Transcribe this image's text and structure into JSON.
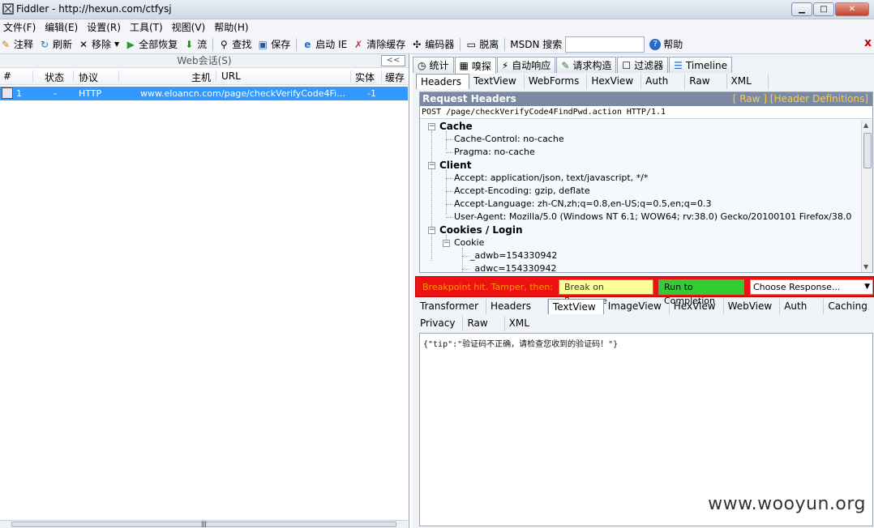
{
  "window": {
    "title": "Fiddler - http://hexun.com/ctfysj"
  },
  "menu": [
    "文件(F)",
    "编辑(E)",
    "设置(R)",
    "工具(T)",
    "视图(V)",
    "帮助(H)"
  ],
  "toolbar": {
    "comment": "注释",
    "refresh": "刷新",
    "remove": "移除",
    "resume_all": "全部恢复",
    "stream": "流",
    "find": "查找",
    "save": "保存",
    "launch_ie": "启动 IE",
    "clear_cache": "清除缓存",
    "encoder": "编码器",
    "tearoff": "脱离",
    "msdn_search": "MSDN 搜索",
    "help": "帮助",
    "close": "x"
  },
  "sessions": {
    "title": "Web会话(S)",
    "collapse": "<<",
    "columns": [
      "#",
      "状态",
      "协议",
      "主机",
      "URL",
      "实体",
      "缓存"
    ],
    "rows": [
      {
        "id": "1",
        "status": "-",
        "protocol": "HTTP",
        "host": "www.eloancn.com",
        "url": "/page/checkVerifyCode4Fi…",
        "body": "-1"
      }
    ]
  },
  "tabs": {
    "main": [
      {
        "label": "统计",
        "icon": "stopwatch-icon"
      },
      {
        "label": "嗅探",
        "icon": "inspect-icon"
      },
      {
        "label": "自动响应",
        "icon": "lightning-icon"
      },
      {
        "label": "请求构造",
        "icon": "compose-icon"
      },
      {
        "label": "过滤器",
        "icon": "checkbox-icon"
      },
      {
        "label": "Timeline",
        "icon": "timeline-icon"
      }
    ],
    "request_sub": [
      "Headers",
      "TextView",
      "WebForms",
      "HexView",
      "Auth",
      "Raw",
      "XML"
    ],
    "response_sub_row1": [
      "Transformer",
      "Headers",
      "TextView",
      "ImageView",
      "HexView",
      "WebView",
      "Auth",
      "Caching"
    ],
    "response_sub_row2": [
      "Privacy",
      "Raw",
      "XML"
    ]
  },
  "request": {
    "header_title": "Request Headers",
    "links": "[ Raw ]   [Header Definitions]",
    "request_line": "POST /page/checkVerifyCode4FindPwd.action HTTP/1.1",
    "groups": {
      "cache": "Cache",
      "cache_control": "Cache-Control: no-cache",
      "pragma": "Pragma: no-cache",
      "client": "Client",
      "accept": "Accept: application/json, text/javascript, */*",
      "accept_encoding": "Accept-Encoding: gzip, deflate",
      "accept_language": "Accept-Language: zh-CN,zh;q=0.8,en-US;q=0.5,en;q=0.3",
      "user_agent": "User-Agent: Mozilla/5.0 (Windows NT 6.1; WOW64; rv:38.0) Gecko/20100101 Firefox/38.0",
      "cookies": "Cookies / Login",
      "cookie": "Cookie",
      "adwb": "_adwb=154330942",
      "adwc": "_adwc=154330942"
    }
  },
  "breakpoint": {
    "message": "Breakpoint hit. Tamper, then:",
    "break_on_response": "Break on Response",
    "run_to_completion": "Run to Completion",
    "choose_response": "Choose Response..."
  },
  "response": {
    "text": "{\"tip\":\"验证码不正确，请检查您收到的验证码！\"}"
  },
  "watermark": "www.wooyun.org"
}
